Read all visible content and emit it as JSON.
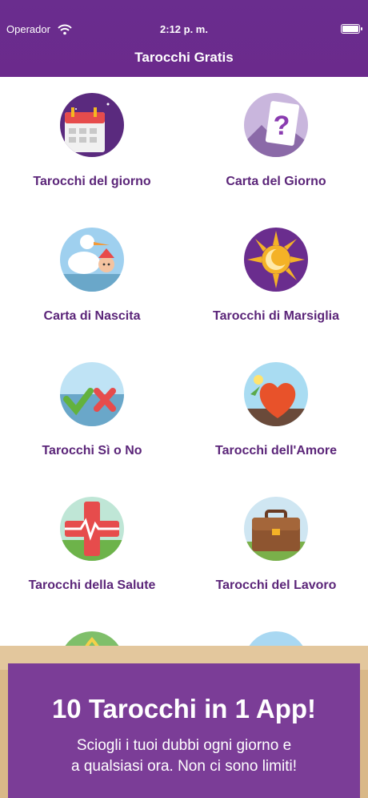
{
  "status_bar": {
    "carrier": "Operador",
    "time": "2:12 p. m."
  },
  "nav": {
    "title": "Tarocchi Gratis"
  },
  "tiles": [
    {
      "label": "Tarocchi del giorno",
      "icon": "calendar-icon"
    },
    {
      "label": "Carta del Giorno",
      "icon": "question-card-icon"
    },
    {
      "label": "Carta di Nascita",
      "icon": "stork-baby-icon"
    },
    {
      "label": "Tarocchi di Marsiglia",
      "icon": "sun-moon-icon"
    },
    {
      "label": "Tarocchi Sì o No",
      "icon": "check-cross-icon"
    },
    {
      "label": "Tarocchi dell'Amore",
      "icon": "heart-icon"
    },
    {
      "label": "Tarocchi della Salute",
      "icon": "health-cross-icon"
    },
    {
      "label": "Tarocchi del Lavoro",
      "icon": "briefcase-icon"
    },
    {
      "label": "",
      "icon": "triquetra-icon"
    },
    {
      "label": "",
      "icon": "eye-icon"
    }
  ],
  "banner": {
    "headline": "10 Tarocchi in 1 App!",
    "line1": "Sciogli i tuoi dubbi ogni giorno e",
    "line2": "a qualsiasi ora. Non ci sono limiti!"
  },
  "colors": {
    "header": "#6b2a8c",
    "label": "#5b2579",
    "banner": "#7b3d97",
    "parchment": "#e3c79d"
  }
}
